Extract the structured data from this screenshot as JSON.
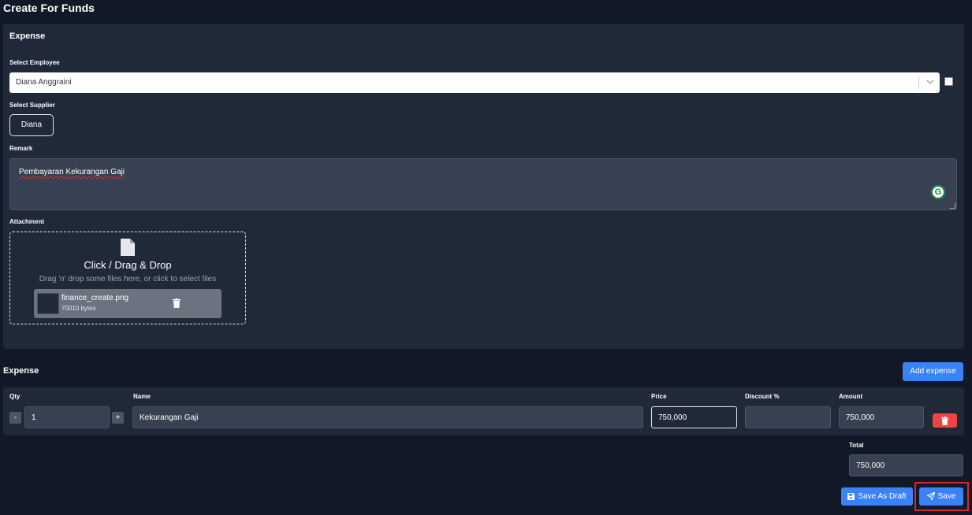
{
  "page": {
    "title": "Create For Funds"
  },
  "expense_card": {
    "title": "Expense",
    "employee_label": "Select Employee",
    "employee_value": "Diana Anggraini",
    "supplier_label": "Select Supplier",
    "supplier_value": "Diana",
    "remark_label": "Remark",
    "remark_value": "Pembayaran Kekurangan Gaji",
    "attachment_label": "Attachment",
    "dropzone_title": "Click / Drag & Drop",
    "dropzone_subtitle": "Drag 'n' drop some files here, or click to select files",
    "file": {
      "name": "finance_create.png",
      "size": "70010 bytes"
    }
  },
  "expense_section": {
    "title": "Expense",
    "add_button": "Add expense",
    "columns": {
      "qty": "Qty",
      "name": "Name",
      "price": "Price",
      "discount": "Discount %",
      "amount": "Amount"
    },
    "row": {
      "qty": "1",
      "name": "Kekurangan Gaji",
      "price": "750,000",
      "discount": "",
      "amount": "750,000"
    },
    "minus": "-",
    "plus": "+",
    "total_label": "Total",
    "total_value": "750,000"
  },
  "actions": {
    "save_draft": "Save As Draft",
    "save": "Save"
  },
  "colors": {
    "background": "#111827",
    "card": "#1f2937",
    "primary": "#3b82f6",
    "danger": "#ef4444",
    "highlight": "#dc2626"
  }
}
